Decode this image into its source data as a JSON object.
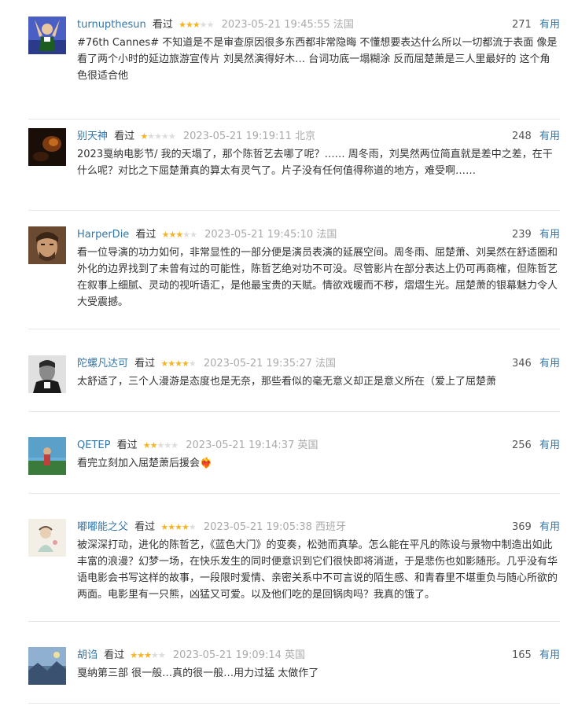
{
  "useful_label": "有用",
  "reviews": [
    {
      "author": "turnupthesun",
      "status": "看过",
      "rating": 3,
      "time": "2023-05-21 19:45:55",
      "location": "法国",
      "votes": "271",
      "content": "#76th Cannes# 不知道是不是审查原因很多东西都非常隐晦 不懂想要表达什么所以一切都流于表面 像是看了两个小时的延边旅游宣传片 刘昊然演得好木… 台词功底一塌糊涂 反而屈楚萧是三人里最好的 这个角色很适合他"
    },
    {
      "author": "别天神",
      "status": "看过",
      "rating": 1,
      "time": "2023-05-21 19:19:11",
      "location": "北京",
      "votes": "248",
      "content": "2023戛纳电影节/ 我的天塌了，那个陈哲艺去哪了呢？…… 周冬雨，刘昊然两位简直就是差中之差，在干什么呢？对比之下屈楚萧真的算太有灵气了。片子没有任何值得称道的地方，难受啊……"
    },
    {
      "author": "HarperDie",
      "status": "看过",
      "rating": 3,
      "time": "2023-05-21 19:45:10",
      "location": "法国",
      "votes": "239",
      "content": "看一位导演的功力如何，非常显性的一部分便是演员表演的延展空间。周冬雨、屈楚萧、刘昊然在舒适圈和外化的边界找到了未曾有过的可能性，陈哲艺绝对功不可没。尽管影片在部分表达上仍可再商榷，但陈哲艺在叙事上细腻、灵动的视听语汇，是他最宝贵的天赋。情欲戏暖而不秽，熠熠生光。屈楚萧的银幕魅力令人大受震撼。"
    },
    {
      "author": "陀螺凡达可",
      "status": "看过",
      "rating": 4,
      "time": "2023-05-21 19:35:27",
      "location": "法国",
      "votes": "346",
      "content": "太舒适了，三个人漫游是态度也是无奈，那些看似的毫无意义却正是意义所在（爱上了屈楚萧"
    },
    {
      "author": "QETEP",
      "status": "看过",
      "rating": 2,
      "time": "2023-05-21 19:14:37",
      "location": "英国",
      "votes": "256",
      "content": "看完立刻加入屈楚萧后援会❤️‍🔥"
    },
    {
      "author": "嘟嘟能之父",
      "status": "看过",
      "rating": 4,
      "time": "2023-05-21 19:05:38",
      "location": "西班牙",
      "votes": "369",
      "content": "被深深打动，进化的陈哲艺，《蓝色大门》的变奏，松弛而真挚。怎么能在平凡的陈设与景物中制造出如此丰富的浪漫？幻梦一场，在快乐发生的同时便意识到它们很快即将消逝，于是悲伤也如影随形。几乎没有华语电影会书写这样的故事，一段限时爱情、亲密关系中不可言说的陌生感、和青春里不堪重负与随心所欲的两面。电影里有一只熊，凶猛又可爱。以及他们吃的是回锅肉吗？我真的饿了。"
    },
    {
      "author": "胡诌",
      "status": "看过",
      "rating": 3,
      "time": "2023-05-21 19:09:14",
      "location": "英国",
      "votes": "165",
      "content": "戛纳第三部 很一般…真的很一般…用力过猛 太做作了"
    }
  ],
  "colors": {
    "link": "#3377aa",
    "star_on": "#f7b422",
    "star_off": "#dddddd",
    "time": "#aaaaaa",
    "divider": "#e6e6e6"
  }
}
